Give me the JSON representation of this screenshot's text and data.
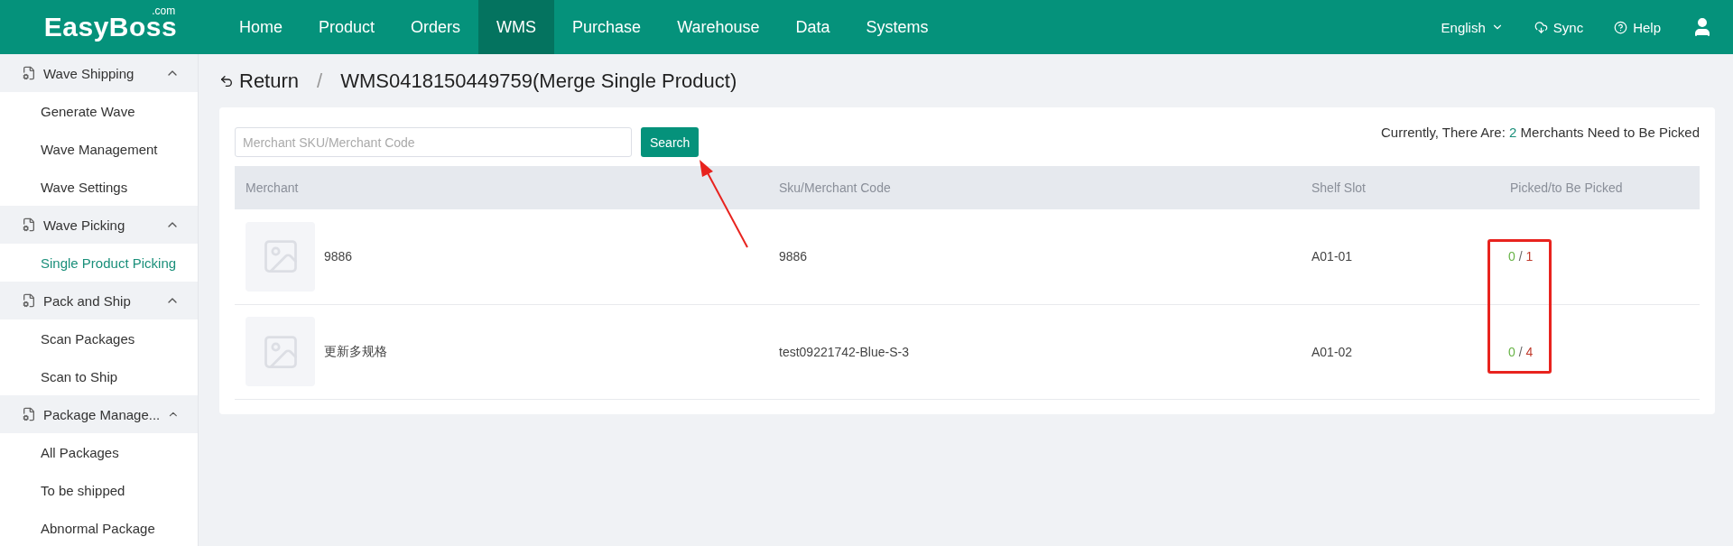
{
  "logo": {
    "name": "EasyBoss",
    "suffix": ".com"
  },
  "nav": [
    {
      "label": "Home",
      "selected": false
    },
    {
      "label": "Product",
      "selected": false
    },
    {
      "label": "Orders",
      "selected": false
    },
    {
      "label": "WMS",
      "selected": true
    },
    {
      "label": "Purchase",
      "selected": false
    },
    {
      "label": "Warehouse",
      "selected": false
    },
    {
      "label": "Data",
      "selected": false
    },
    {
      "label": "Systems",
      "selected": false
    }
  ],
  "header_right": {
    "language": "English",
    "sync": "Sync",
    "help": "Help"
  },
  "sidebar": [
    {
      "label": "Wave Shipping",
      "expanded": true,
      "children": [
        {
          "label": "Generate Wave",
          "selected": false
        },
        {
          "label": "Wave Management",
          "selected": false
        },
        {
          "label": "Wave Settings",
          "selected": false
        }
      ]
    },
    {
      "label": "Wave Picking",
      "expanded": true,
      "children": [
        {
          "label": "Single Product Picking",
          "selected": true
        }
      ]
    },
    {
      "label": "Pack and Ship",
      "expanded": true,
      "children": [
        {
          "label": "Scan Packages",
          "selected": false
        },
        {
          "label": "Scan to Ship",
          "selected": false
        }
      ]
    },
    {
      "label": "Package Manage...",
      "expanded": true,
      "children": [
        {
          "label": "All Packages",
          "selected": false
        },
        {
          "label": "To be shipped",
          "selected": false
        },
        {
          "label": "Abnormal Package",
          "selected": false
        }
      ]
    }
  ],
  "page": {
    "back": "Return",
    "separator": "/",
    "title": "WMS0418150449759(Merge Single Product)"
  },
  "search": {
    "placeholder": "Merchant SKU/Merchant Code",
    "button": "Search"
  },
  "summary": {
    "before": "Currently, There Are:",
    "count": "2",
    "after": "Merchants Need to Be Picked"
  },
  "table": {
    "columns": [
      "Merchant",
      "Sku/Merchant Code",
      "Shelf Slot",
      "Picked/to Be Picked"
    ],
    "rows": [
      {
        "merchant": "9886",
        "sku": "9886",
        "slot": "A01-01",
        "picked": "0",
        "separator": "/",
        "total": "1"
      },
      {
        "merchant": "更新多规格",
        "sku": "test09221742-Blue-S-3",
        "slot": "A01-02",
        "picked": "0",
        "separator": "/",
        "total": "4"
      }
    ]
  }
}
